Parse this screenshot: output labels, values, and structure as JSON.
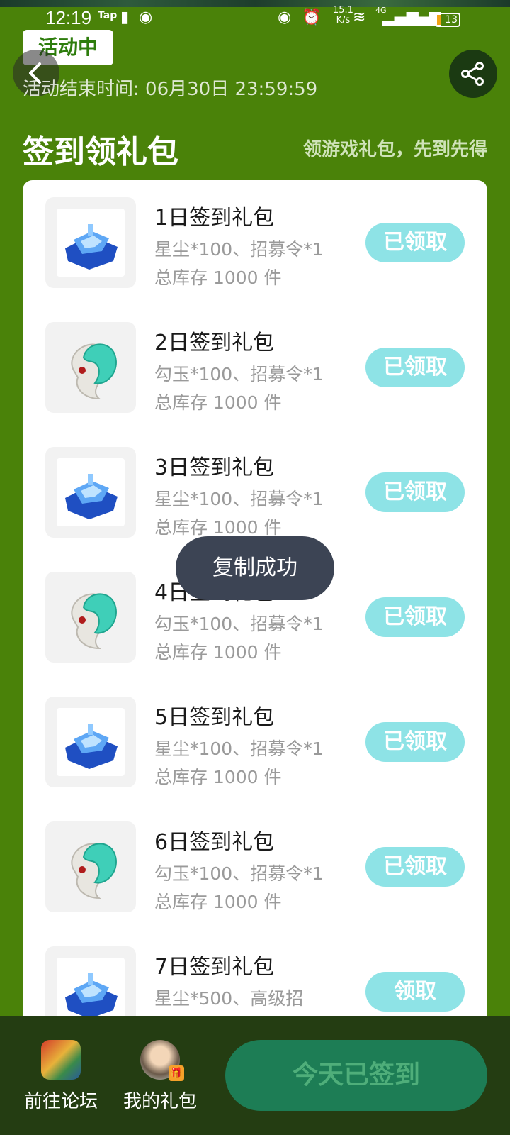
{
  "status_bar": {
    "time": "12:19",
    "tap_label": "Tap",
    "net_speed_value": "15.1",
    "net_speed_unit": "K/s",
    "network_type": "4G",
    "battery": "13"
  },
  "header": {
    "badge": "活动中",
    "end_time": "活动结束时间: 06月30日 23:59:59",
    "title": "签到领礼包",
    "subtitle": "领游戏礼包，先到先得"
  },
  "items": [
    {
      "title": "1日签到礼包",
      "desc": "星尘*100、招募令*1",
      "stock": "总库存 1000 件",
      "button": "已领取",
      "icon": "blue-crystal-icon"
    },
    {
      "title": "2日签到礼包",
      "desc": "勾玉*100、招募令*1",
      "stock": "总库存 1000 件",
      "button": "已领取",
      "icon": "jade-magatama-icon"
    },
    {
      "title": "3日签到礼包",
      "desc": "星尘*100、招募令*1",
      "stock": "总库存 1000 件",
      "button": "已领取",
      "icon": "blue-crystal-icon"
    },
    {
      "title": "4日签到礼包",
      "desc": "勾玉*100、招募令*1",
      "stock": "总库存 1000 件",
      "button": "已领取",
      "icon": "jade-magatama-icon"
    },
    {
      "title": "5日签到礼包",
      "desc": "星尘*100、招募令*1",
      "stock": "总库存 1000 件",
      "button": "已领取",
      "icon": "blue-crystal-icon"
    },
    {
      "title": "6日签到礼包",
      "desc": "勾玉*100、招募令*1",
      "stock": "总库存 1000 件",
      "button": "已领取",
      "icon": "jade-magatama-icon"
    },
    {
      "title": "7日签到礼包",
      "desc": "星尘*500、高级招",
      "stock": "",
      "button": "领取",
      "icon": "blue-crystal-icon"
    }
  ],
  "toast": "复制成功",
  "bottom_bar": {
    "forum_label": "前往论坛",
    "gifts_label": "我的礼包",
    "checkin_label": "今天已签到"
  },
  "colors": {
    "background": "#4a8209",
    "claimed_button": "#8ee3e6",
    "checkin_button": "#1d7d55",
    "bottom_bar": "#243d12"
  }
}
